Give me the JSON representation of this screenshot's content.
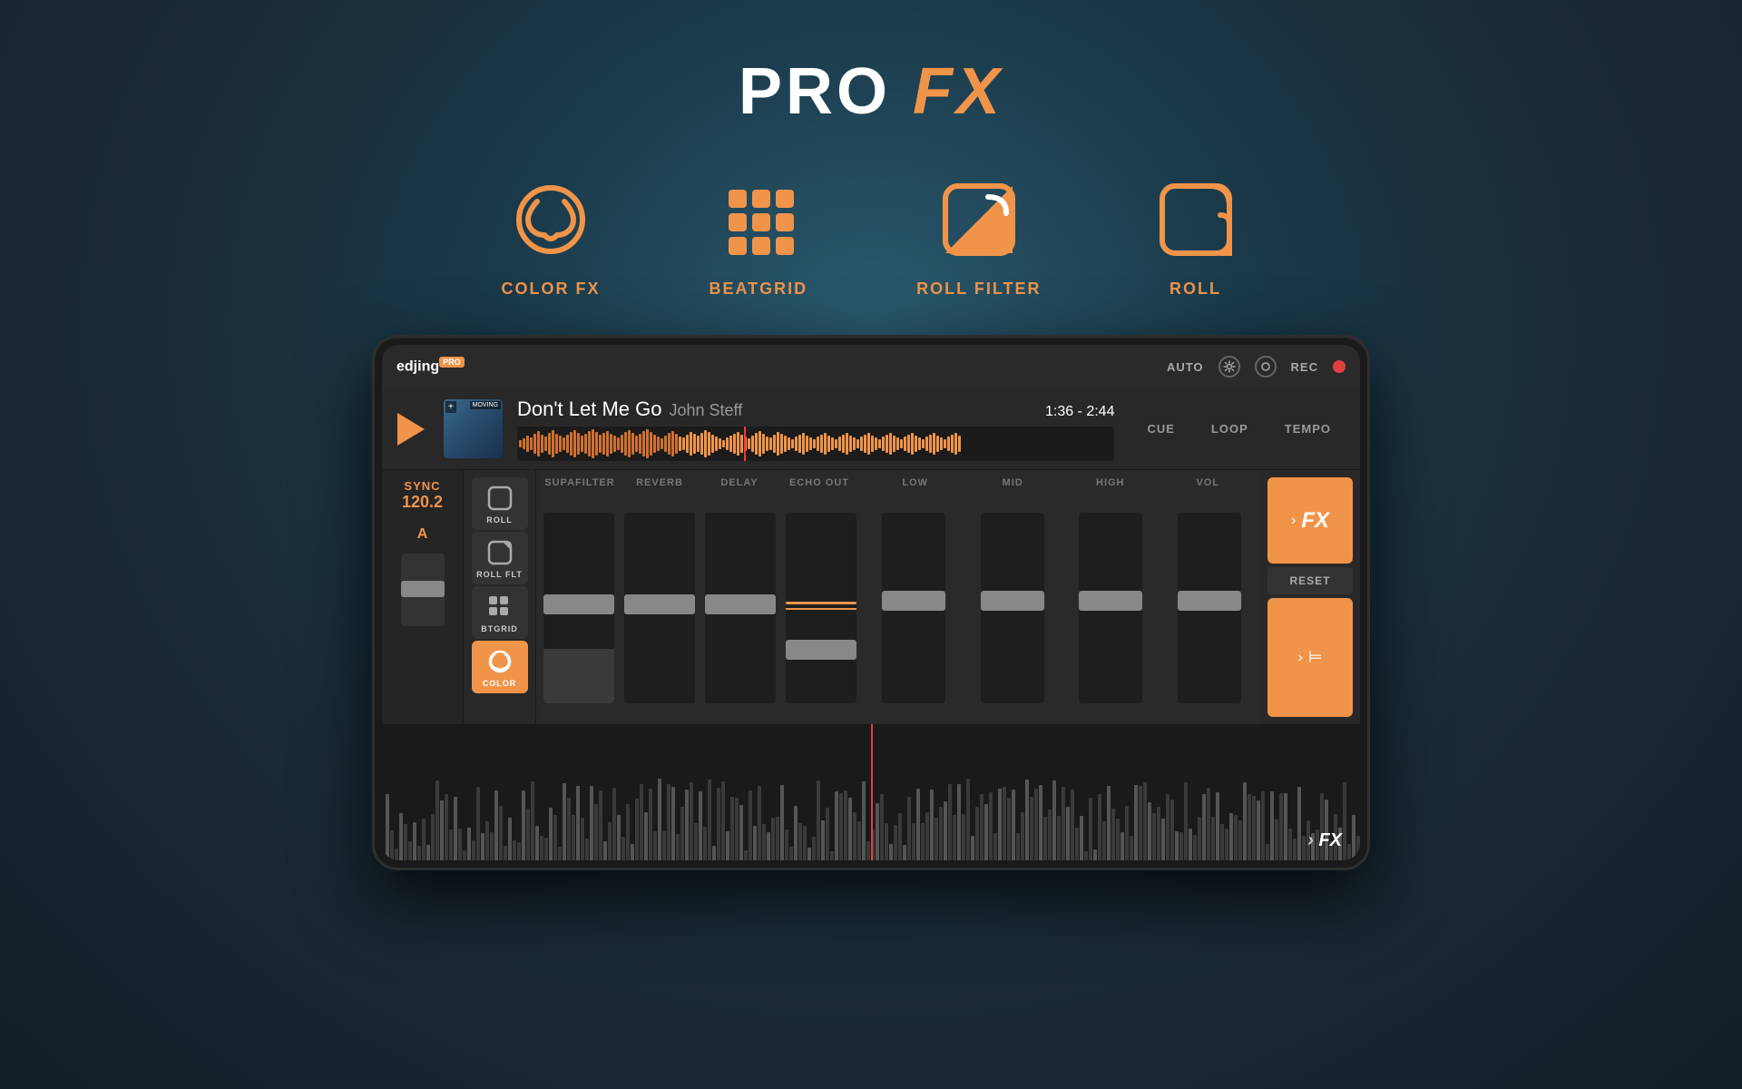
{
  "header": {
    "title_bold": "PRO",
    "title_italic": "FX"
  },
  "features": [
    {
      "id": "color-fx",
      "label": "COLOR FX",
      "icon": "color-fx-icon"
    },
    {
      "id": "beatgrid",
      "label": "BEATGRID",
      "icon": "beatgrid-icon"
    },
    {
      "id": "roll-filter",
      "label": "ROLL FILTER",
      "icon": "roll-filter-icon"
    },
    {
      "id": "roll",
      "label": "ROLL",
      "icon": "roll-icon"
    }
  ],
  "app": {
    "logo": "edjing",
    "logo_suffix": "PRO",
    "auto_label": "AUTO",
    "rec_label": "REC"
  },
  "track": {
    "title": "Don't Let Me Go",
    "artist": "John Steff",
    "time": "1:36 - 2:44",
    "cue_label": "CUE",
    "loop_label": "LOOP",
    "tempo_label": "TEMPO",
    "album_tag": "MOVING"
  },
  "sync": {
    "label": "SYNC",
    "bpm": "120.2",
    "key": "A"
  },
  "fx_controls": {
    "supafilter": "SUPAFILTER",
    "reverb": "REVERB",
    "delay": "DELAY",
    "echo_out": "ECHO OUT"
  },
  "eq": {
    "low": "LOW",
    "mid": "MID",
    "high": "HIGH",
    "vol": "VOL"
  },
  "buttons": {
    "fx_label": "FX",
    "reset_label": "RESET",
    "roll_label": "ROLL",
    "roll_flt_label": "ROLL FLT",
    "btgrid_label": "BTGRID",
    "color_label": "COLOR"
  },
  "colors": {
    "accent": "#f0944a",
    "bg_dark": "#1a1a1a",
    "bg_mid": "#282828",
    "text_muted": "#999999"
  }
}
